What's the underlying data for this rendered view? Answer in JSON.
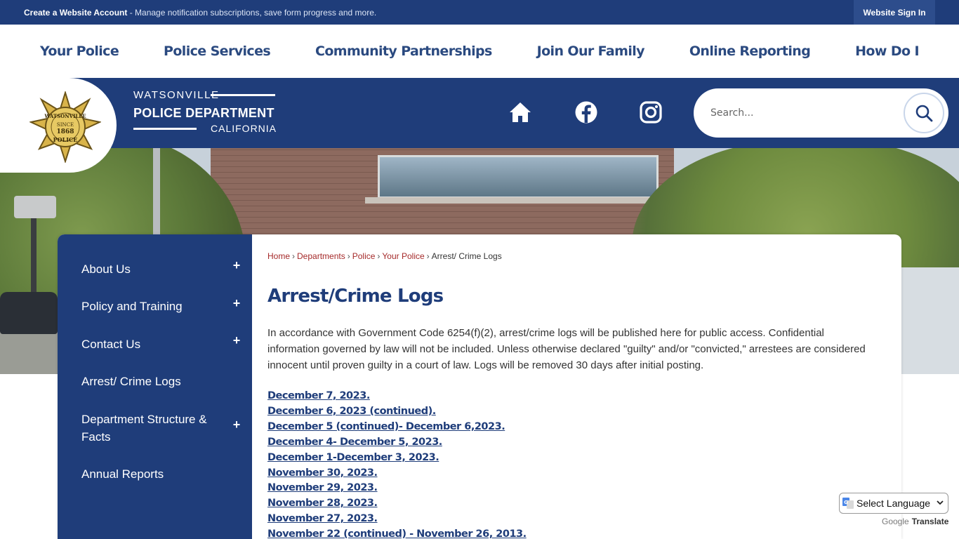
{
  "topbar": {
    "notice_bold": "Create a Website Account",
    "notice_rest": " - Manage notification subscriptions, save form progress and more.",
    "signin_label": "Website Sign In"
  },
  "nav": {
    "items": [
      "Your Police",
      "Police Services",
      "Community Partnerships",
      "Join Our Family",
      "Online Reporting",
      "How Do I"
    ]
  },
  "brand": {
    "line1": "WATSONVILLE",
    "line2": "POLICE DEPARTMENT",
    "line3": "CALIFORNIA",
    "badge_top": "WATSONVILLE",
    "badge_since": "SINCE",
    "badge_year": "1868",
    "badge_bottom": "POLICE"
  },
  "social": {
    "icons": [
      "home-icon",
      "facebook-icon",
      "instagram-icon"
    ]
  },
  "search": {
    "placeholder": "Search..."
  },
  "sidebar": {
    "items": [
      {
        "label": "About Us",
        "expandable": "+"
      },
      {
        "label": "Policy and Training",
        "expandable": "+"
      },
      {
        "label": "Contact Us",
        "expandable": "+"
      },
      {
        "label": "Arrest/ Crime Logs"
      },
      {
        "label": "Department Structure & Facts",
        "expandable": "+"
      },
      {
        "label": "Annual Reports"
      }
    ]
  },
  "breadcrumb": {
    "links": [
      "Home",
      "Departments",
      "Police",
      "Your Police"
    ],
    "current": "Arrest/ Crime Logs",
    "separator": "›"
  },
  "page": {
    "title": "Arrest/Crime Logs",
    "intro": "In accordance with Government Code 6254(f)(2), arrest/crime logs will be published here for public access. Confidential information governed by law will not be included. Unless otherwise declared \"guilty\" and/or \"convicted,\" arrestees are considered innocent until proven guilty in a court of law. Logs will be removed 30 days after initial posting.",
    "logs": [
      "December 7, 2023.",
      "December 6, 2023 (continued).",
      "December 5 (continued)- December 6,2023.",
      "December 4- December 5, 2023.",
      "December 1-December 3, 2023.",
      "November 30, 2023.",
      "November 29, 2023.",
      "November 28, 2023.",
      "November 27, 2023.",
      "November 22 (continued) - November 26, 2013."
    ]
  },
  "translate": {
    "select_label": "Select Language",
    "powered_google": "Google",
    "powered_translate": "Translate"
  },
  "colors": {
    "navy": "#1f3d7a",
    "nav_text": "#2b4a80",
    "breadcrumb_link": "#a52a2a",
    "badge_gold": "#d9b44a"
  }
}
